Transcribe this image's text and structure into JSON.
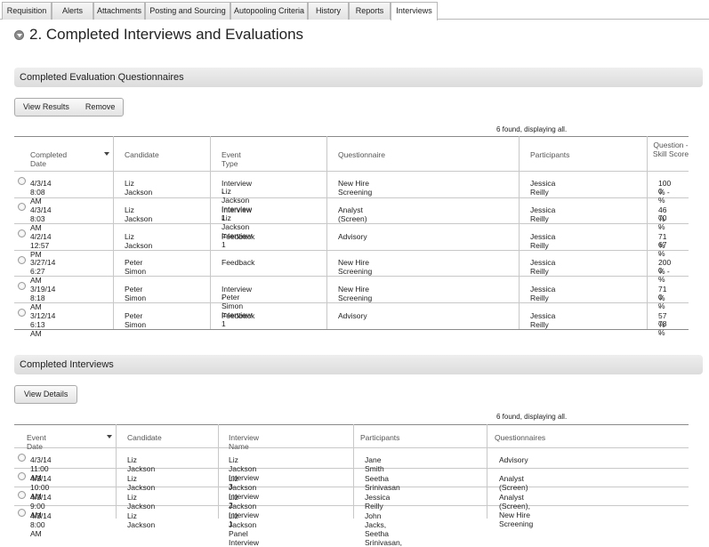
{
  "tabs": [
    {
      "label": "Requisition"
    },
    {
      "label": "Alerts"
    },
    {
      "label": "Attachments"
    },
    {
      "label": "Posting and Sourcing"
    },
    {
      "label": "Autopooling Criteria"
    },
    {
      "label": "History"
    },
    {
      "label": "Reports"
    },
    {
      "label": "Interviews"
    }
  ],
  "active_tab": "Interviews",
  "page_title": "2. Completed Interviews and Evaluations",
  "evaluations": {
    "header": "Completed Evaluation Questionnaires",
    "buttons": {
      "view_results": "View Results",
      "remove": "Remove"
    },
    "count_text": "6 found, displaying all.",
    "columns": [
      "Completed Date",
      "Candidate",
      "Event Type",
      "Questionnaire",
      "Participants",
      "Question - Skill Score"
    ],
    "rows": [
      {
        "date": "4/3/14 8:08 AM",
        "candidate": "Liz Jackson",
        "event_line1": "Interview -",
        "event_line2": "Liz Jackson Interview 1",
        "questionnaire": "New Hire Screening",
        "participants": "Jessica Reilly",
        "score_line1": "100 % -",
        "score_line2": "0 %"
      },
      {
        "date": "4/3/14 8:03 AM",
        "candidate": "Liz Jackson",
        "event_line1": "Interview -",
        "event_line2": "Liz Jackson Interview 1",
        "questionnaire": "Analyst (Screen)",
        "participants": "Jessica Reilly",
        "score_line1": "46 % -",
        "score_line2": "70 %"
      },
      {
        "date": "4/2/14 12:57 PM",
        "candidate": "Liz Jackson",
        "event_line1": "Feedback",
        "event_line2": "",
        "questionnaire": "Advisory",
        "participants": "Jessica Reilly",
        "score_line1": "71 % -",
        "score_line2": "67 %"
      },
      {
        "date": "3/27/14 6:27 AM",
        "candidate": "Peter Simon",
        "event_line1": "Feedback",
        "event_line2": "",
        "questionnaire": "New Hire Screening",
        "participants": "Jessica Reilly",
        "score_line1": "200 % -",
        "score_line2": "0 %"
      },
      {
        "date": "3/19/14 8:18 AM",
        "candidate": "Peter Simon",
        "event_line1": "Interview -",
        "event_line2": "Peter Simon Interview 1",
        "questionnaire": "New Hire Screening",
        "participants": "Jessica Reilly",
        "score_line1": "71 % -",
        "score_line2": "0 %"
      },
      {
        "date": "3/12/14 6:13 AM",
        "candidate": "Peter Simon",
        "event_line1": "Feedback",
        "event_line2": "",
        "questionnaire": "Advisory",
        "participants": "Jessica Reilly",
        "score_line1": "57 % -",
        "score_line2": "78 %"
      }
    ]
  },
  "interviews": {
    "header": "Completed Interviews",
    "buttons": {
      "view_details": "View Details"
    },
    "count_text": "6 found, displaying all.",
    "columns": [
      "Event Date",
      "Candidate",
      "Interview Name",
      "Participants",
      "Questionnaires"
    ],
    "rows": [
      {
        "date": "4/3/14 11:00 AM",
        "candidate": "Liz Jackson",
        "name": "Liz Jackson Interview 3",
        "participants": "Jane Smith",
        "questionnaires": "Advisory"
      },
      {
        "date": "4/3/14 10:00 AM",
        "candidate": "Liz Jackson",
        "name": "Liz Jackson Interview 2",
        "participants": "Seetha Srinivasan",
        "questionnaires": "Analyst (Screen)"
      },
      {
        "date": "4/3/14 9:00 AM",
        "candidate": "Liz Jackson",
        "name": "Liz Jackson Interview 1",
        "participants": "Jessica Reilly",
        "questionnaires": "Analyst (Screen), New Hire Screening"
      },
      {
        "date": "4/3/14 8:00 AM",
        "candidate": "Liz Jackson",
        "name": "Liz Jackson Panel Interview",
        "participants": "John Jacks, Seetha Srinivasan,",
        "questionnaires": ""
      }
    ]
  }
}
